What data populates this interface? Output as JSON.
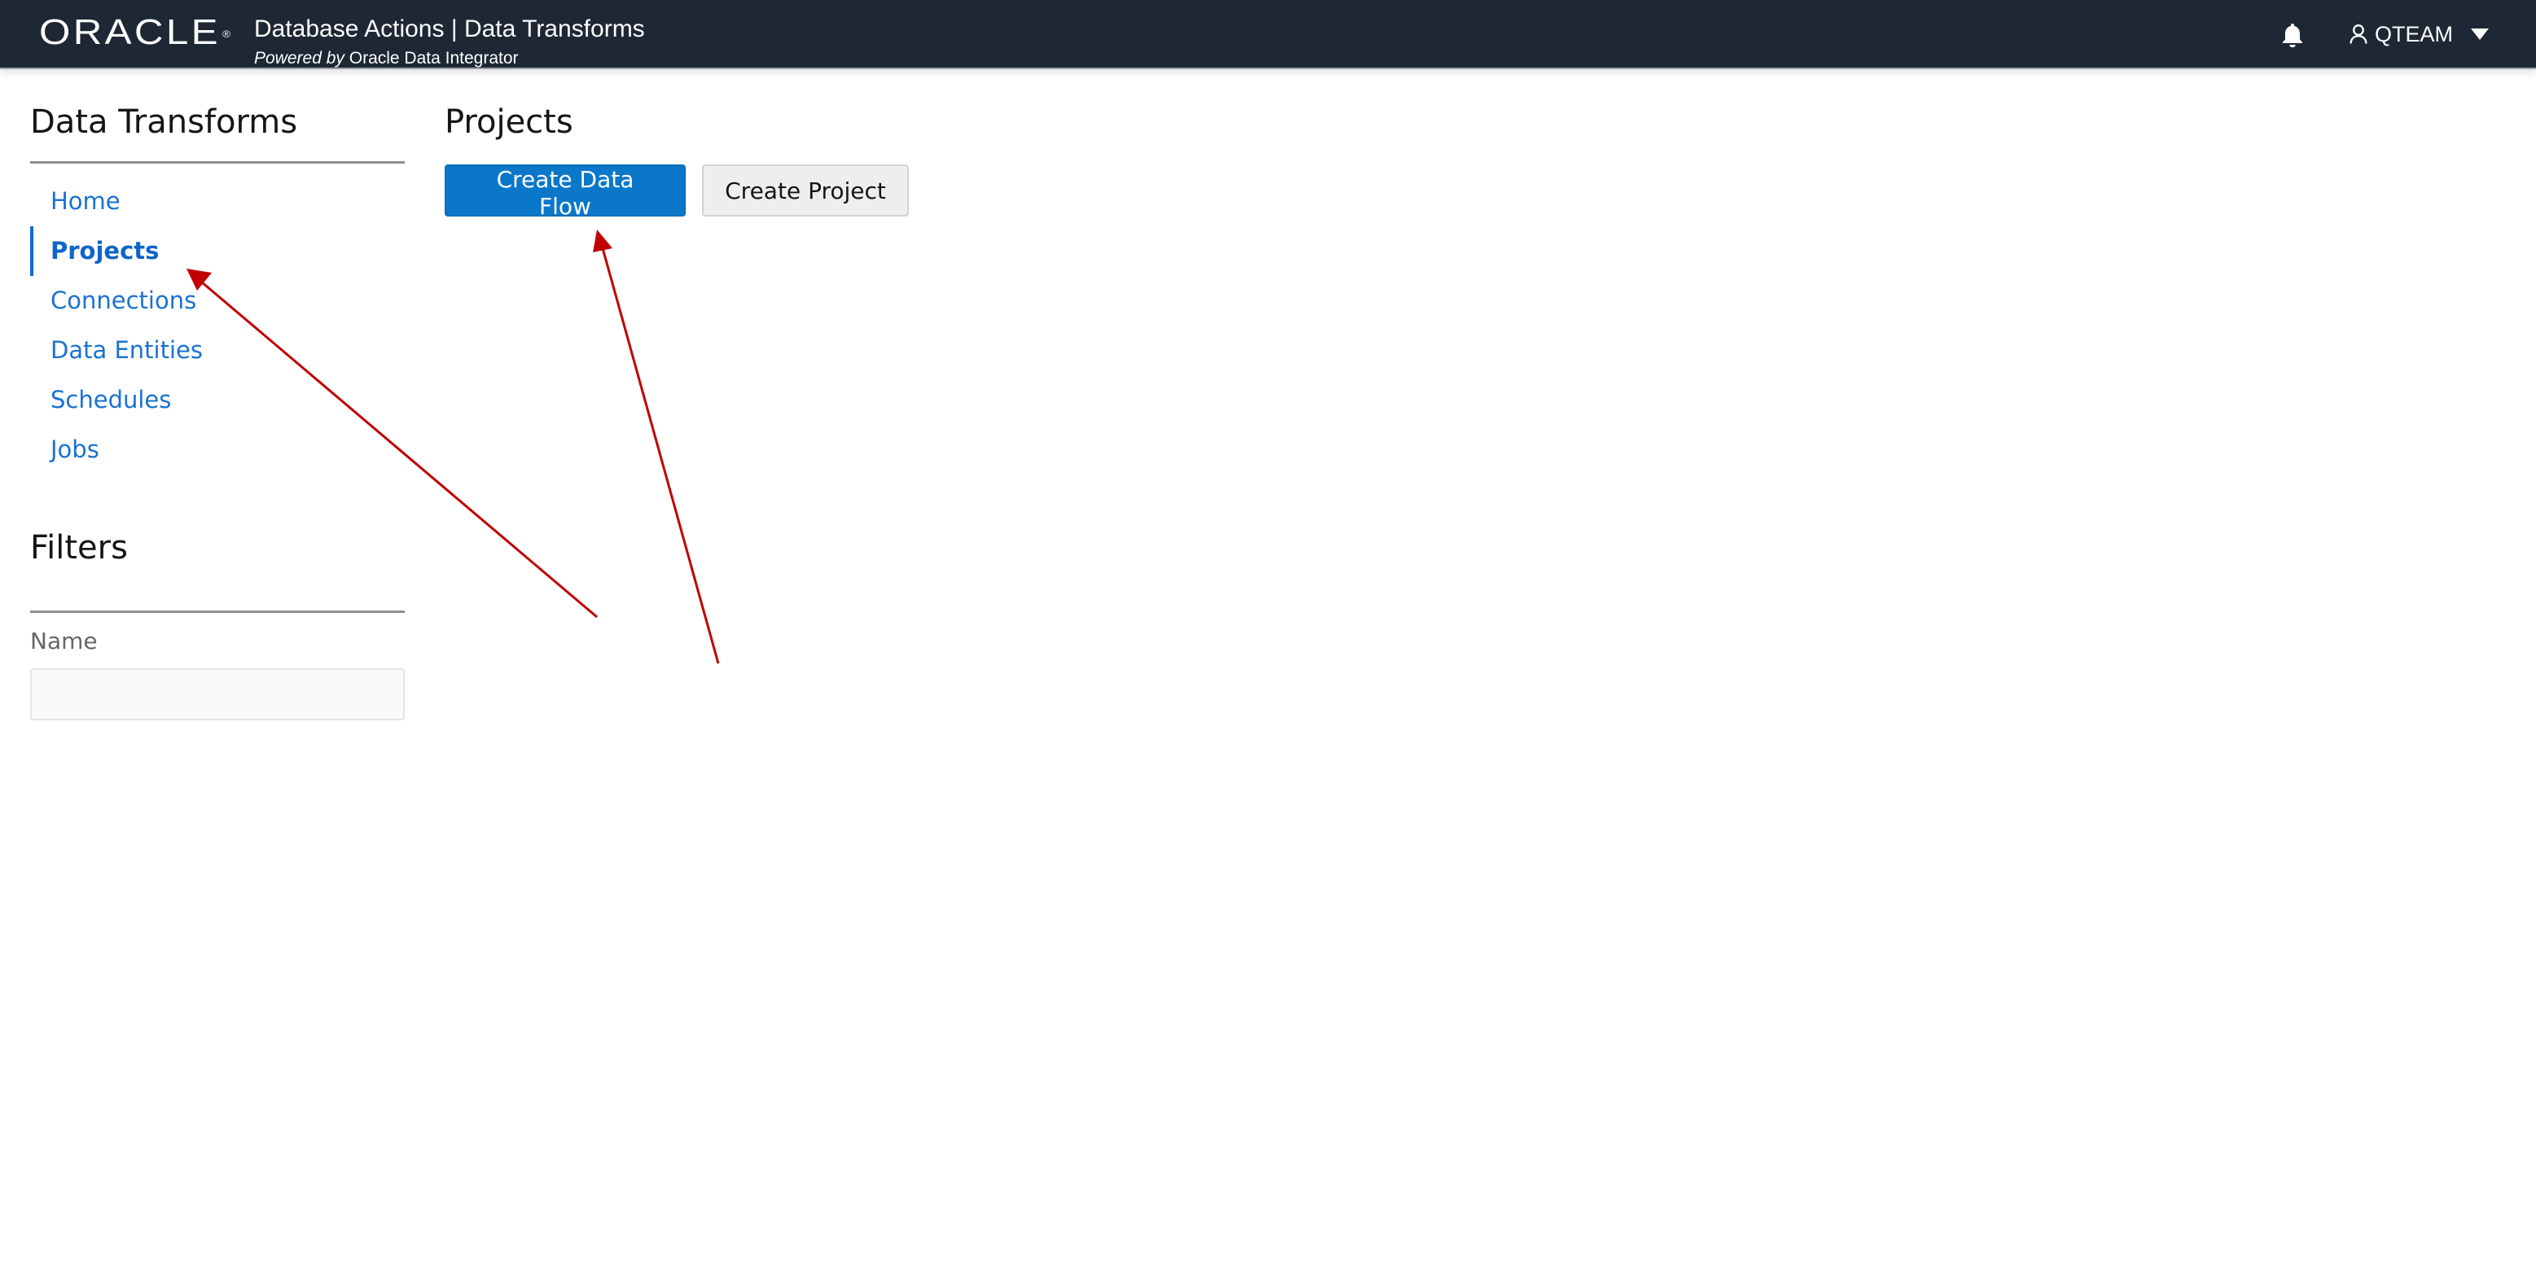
{
  "header": {
    "logo": "ORACLE",
    "logo_mark": "®",
    "app_title": "Database Actions | Data Transforms",
    "powered_prefix": "Powered by",
    "powered_product": "Oracle Data Integrator",
    "user_name": "QTEAM",
    "icons": {
      "notifications": "bell-icon",
      "user": "user-icon",
      "user_menu": "caret-down-icon"
    }
  },
  "sidebar": {
    "title": "Data Transforms",
    "items": [
      {
        "label": "Home",
        "active": false
      },
      {
        "label": "Projects",
        "active": true
      },
      {
        "label": "Connections",
        "active": false
      },
      {
        "label": "Data Entities",
        "active": false
      },
      {
        "label": "Schedules",
        "active": false
      },
      {
        "label": "Jobs",
        "active": false
      }
    ],
    "filters": {
      "title": "Filters",
      "name_label": "Name",
      "name_value": "",
      "name_placeholder": ""
    }
  },
  "main": {
    "title": "Projects",
    "actions": {
      "create_data_flow": "Create Data Flow",
      "create_project": "Create Project"
    }
  },
  "annotations": {
    "arrow_color": "#c00000",
    "arrows": [
      {
        "points_to": "sidebar-item-projects"
      },
      {
        "points_to": "create-data-flow-button"
      }
    ]
  },
  "colors": {
    "header_bg": "#1e2734",
    "accent": "#0a77c9",
    "link": "#1b72d1"
  }
}
